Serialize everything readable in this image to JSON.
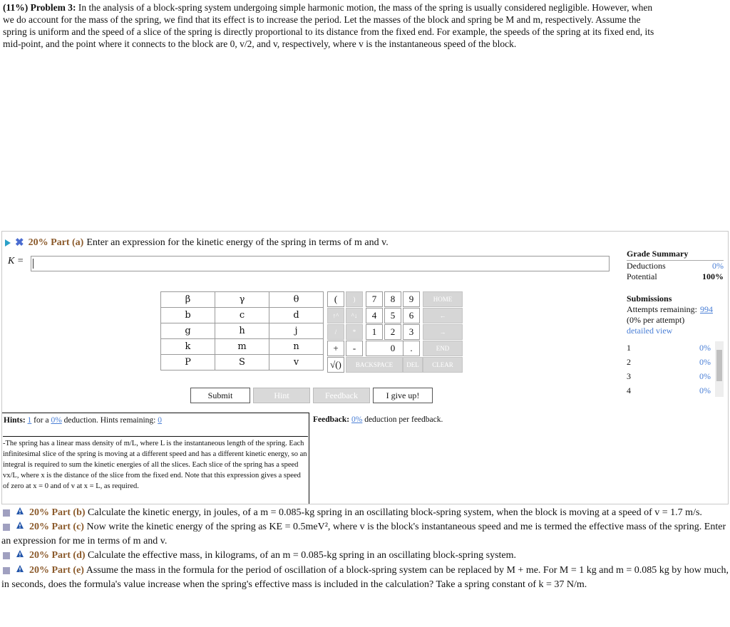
{
  "problem": {
    "header": "(11%) Problem 3:",
    "text": "In the analysis of a block-spring system undergoing simple harmonic motion, the mass of the spring is usually considered negligible. However, when we do account for the mass of the spring, we find that its effect is to increase the period. Let the masses of the block and spring be M and m, respectively. Assume the spring is uniform and the speed of a slice of the spring is directly proportional to its distance from the fixed end. For example, the speeds of the spring at its fixed end, its mid-point, and the point where it connects to the block are 0, v/2, and v, respectively, where v is the instantaneous speed of the block."
  },
  "part_a": {
    "percent": "20% Part (a)",
    "prompt": "Enter an expression for the kinetic energy of the spring in terms of m and v.",
    "answer_label": "K =",
    "answer_value": ""
  },
  "keypad": {
    "rows": [
      [
        "β",
        "γ",
        "θ"
      ],
      [
        "b",
        "c",
        "d"
      ],
      [
        "g",
        "h",
        "j"
      ],
      [
        "k",
        "m",
        "n"
      ],
      [
        "P",
        "S",
        "v"
      ]
    ]
  },
  "numpad": {
    "keys": [
      "(",
      ")",
      "7",
      "8",
      "9",
      "↑^",
      "^↓",
      "4",
      "5",
      "6",
      "/",
      "*",
      "1",
      "2",
      "3",
      "+",
      "-",
      "0",
      ".",
      "√()"
    ],
    "functions": [
      "HOME",
      "←",
      "→",
      "END",
      "BACKSPACE",
      "DEL",
      "CLEAR"
    ]
  },
  "buttons": {
    "submit": "Submit",
    "hint": "Hint",
    "feedback": "Feedback",
    "giveup": "I give up!"
  },
  "grade": {
    "title": "Grade Summary",
    "deductions_label": "Deductions",
    "deductions_value": "0%",
    "potential_label": "Potential",
    "potential_value": "100%",
    "submissions_title": "Submissions",
    "attempts_label": "Attempts remaining:",
    "attempts_value": "994",
    "per_attempt": "(0% per attempt)",
    "detailed": "detailed view",
    "rows": [
      [
        "1",
        "0%"
      ],
      [
        "2",
        "0%"
      ],
      [
        "3",
        "0%"
      ],
      [
        "4",
        "0%"
      ]
    ]
  },
  "hints": {
    "label": "Hints:",
    "count": "1",
    "for_a": "for a",
    "deduction": "0%",
    "remaining_label": "deduction. Hints remaining:",
    "remaining": "0",
    "text": "-The spring has a linear mass density of m/L, where L is the instantaneous length of the spring. Each infinitesimal slice of the spring is moving at a different speed and has a different kinetic energy, so an integral is required to sum the kinetic energies of all the slices. Each slice of the spring has a speed vx/L, where x is the distance of the slice from the fixed end. Note that this expression gives a speed of zero at x = 0 and of v at x = L, as required."
  },
  "feedback": {
    "label": "Feedback:",
    "value": "0%",
    "suffix": "deduction per feedback."
  },
  "parts": [
    {
      "pct": "20% Part (b)",
      "text": "Calculate the kinetic energy, in joules, of a m = 0.085-kg spring in an oscillating block-spring system, when the block is moving at a speed of v = 1.7 m/s."
    },
    {
      "pct": "20% Part (c)",
      "text": "Now write the kinetic energy of the spring as KE = 0.5meV², where v is the block's instantaneous speed and me is termed the effective mass of the spring. Enter an expression for me in terms of m and v."
    },
    {
      "pct": "20% Part (d)",
      "text": "Calculate the effective mass, in kilograms, of an m = 0.085-kg spring in an oscillating block-spring system."
    },
    {
      "pct": "20% Part (e)",
      "text": "Assume the mass in the formula for the period of oscillation of a block-spring system can be replaced by M + me. For M = 1 kg and m = 0.085 kg by how much, in seconds, does the formula's value increase when the spring's effective mass is included in the calculation? Take a spring constant of k = 37 N/m."
    }
  ]
}
